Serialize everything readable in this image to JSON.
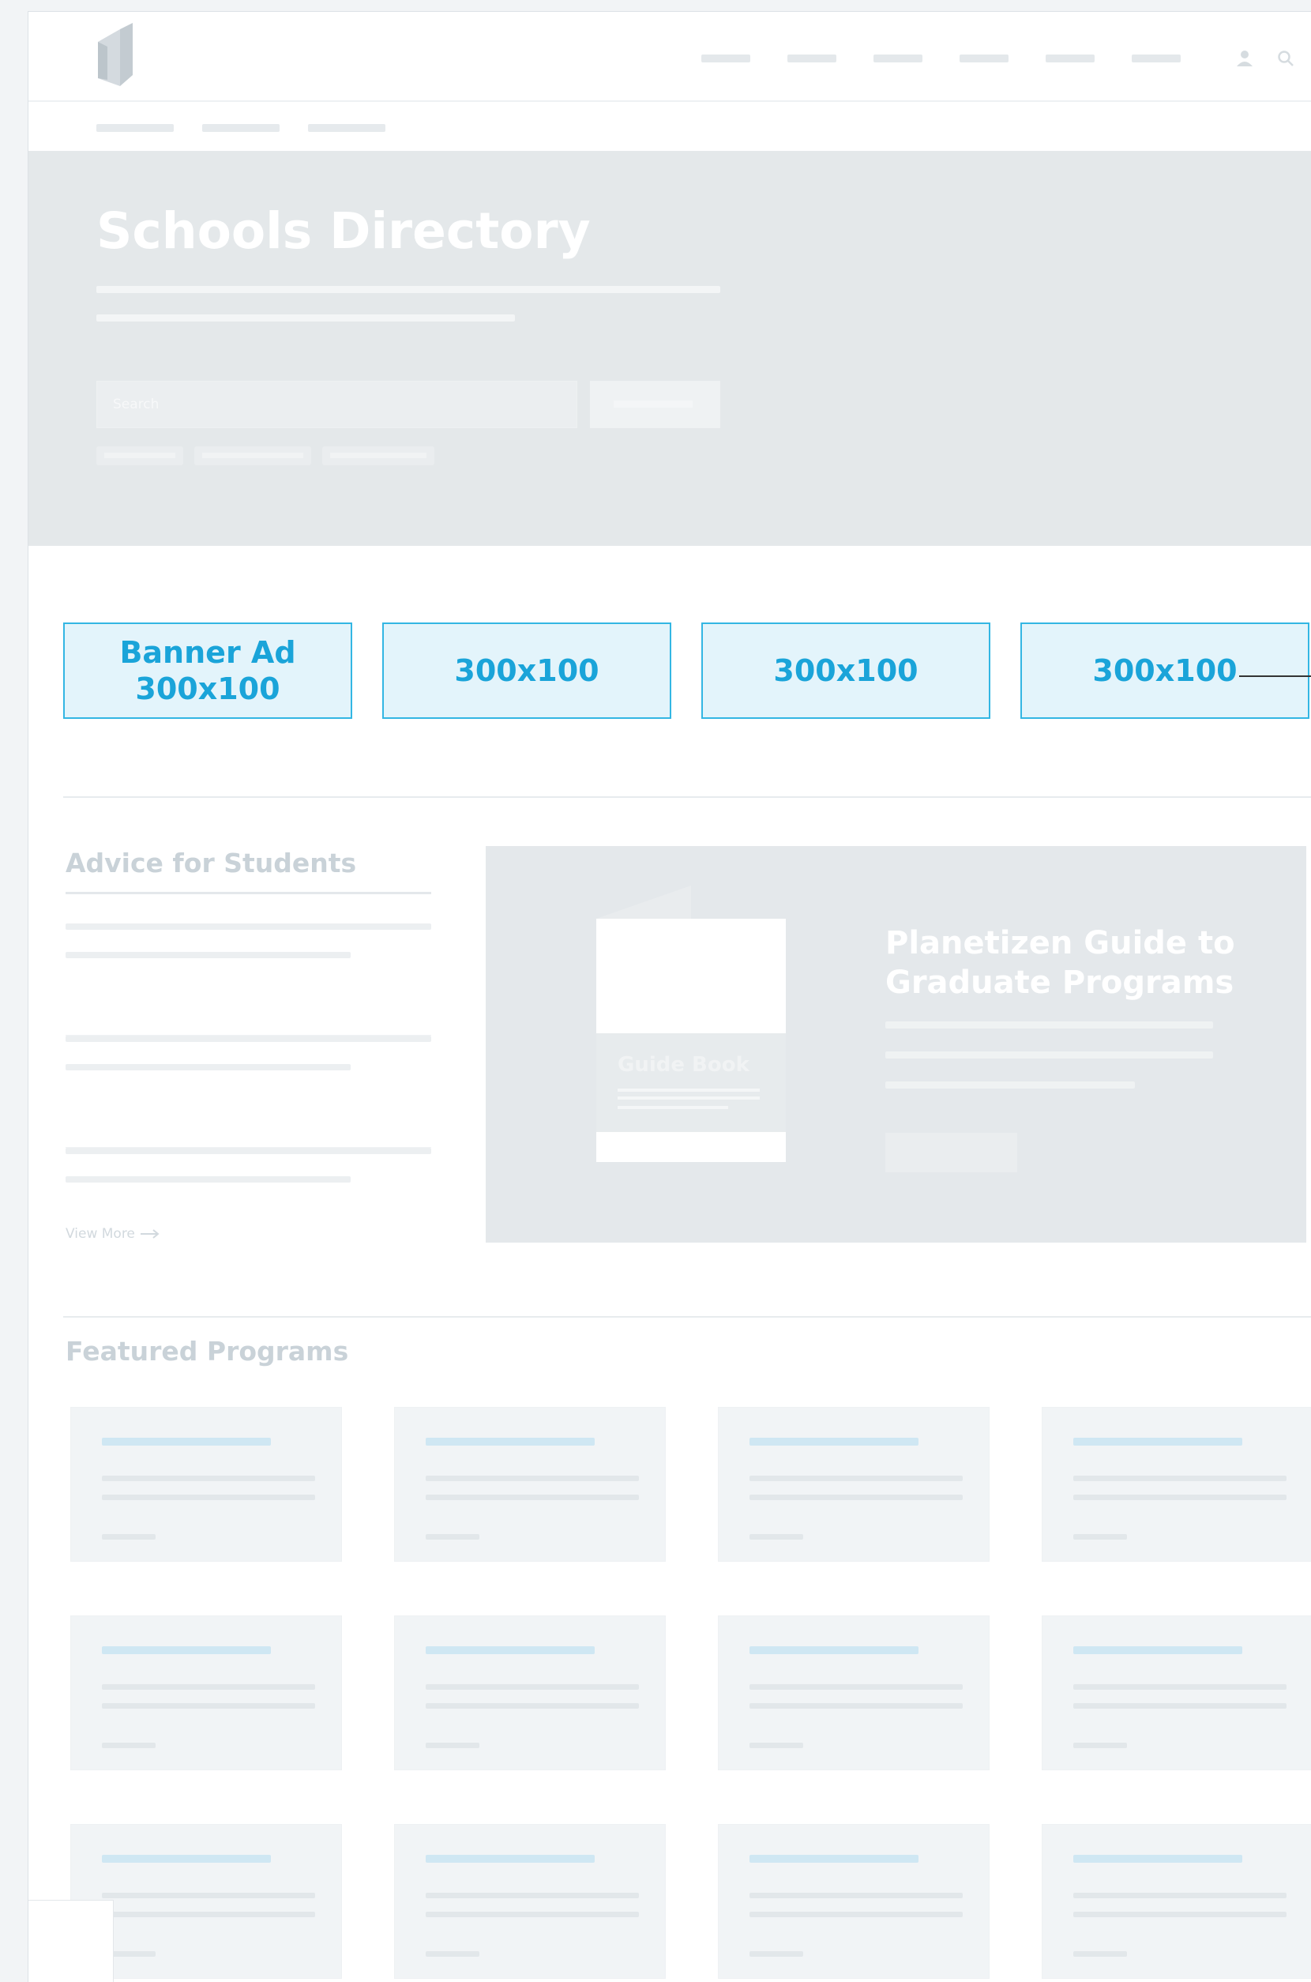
{
  "hero": {
    "title": "Schools Directory",
    "search_placeholder": "Search"
  },
  "banner_ads": [
    {
      "label_line1": "Banner Ad",
      "label_line2": "300x100"
    },
    {
      "label_line1": "",
      "label_line2": "300x100"
    },
    {
      "label_line1": "",
      "label_line2": "300x100"
    },
    {
      "label_line1": "",
      "label_line2": "300x100"
    }
  ],
  "advice": {
    "title": "Advice for Students",
    "view_more": "View More"
  },
  "guide": {
    "book_label": "Guide Book",
    "title_line1": "Planetizen Guide to",
    "title_line2": "Graduate Programs"
  },
  "featured": {
    "title": "Featured Programs",
    "card_count": 12
  },
  "colors": {
    "ad_accent": "#33b6e3",
    "ad_text": "#1aa4d9",
    "hero_bg": "#e4e8ea"
  }
}
